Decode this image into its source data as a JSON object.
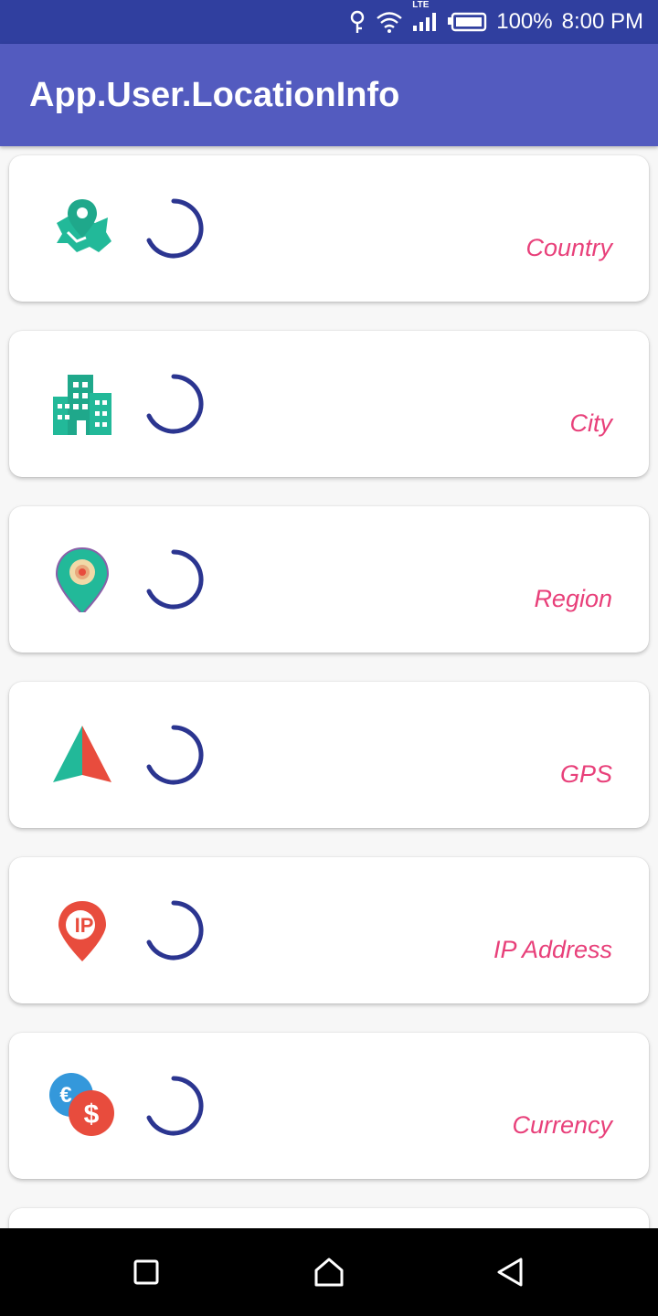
{
  "status_bar": {
    "network_label": "LTE",
    "battery_percent": "100%",
    "time": "8:00 PM",
    "icons": [
      "key-icon",
      "wifi-icon",
      "signal-icon",
      "battery-icon"
    ]
  },
  "app_bar": {
    "title": "App.User.LocationInfo"
  },
  "cards": [
    {
      "label": "Country",
      "icon": "country-map-pin-icon",
      "loading": true
    },
    {
      "label": "City",
      "icon": "city-buildings-icon",
      "loading": true
    },
    {
      "label": "Region",
      "icon": "region-pin-icon",
      "loading": true
    },
    {
      "label": "GPS",
      "icon": "gps-arrow-icon",
      "loading": true
    },
    {
      "label": "IP Address",
      "icon": "ip-pin-icon",
      "icon_text": "IP",
      "loading": true
    },
    {
      "label": "Currency",
      "icon": "currency-coins-icon",
      "icon_text": [
        "€",
        "$"
      ],
      "loading": true
    }
  ],
  "navigation_bar": {
    "buttons": [
      "recent-apps",
      "home",
      "back"
    ]
  },
  "colors": {
    "status_bar": "#303f9f",
    "app_bar": "#535bbf",
    "label": "#e8407a",
    "spinner": "#2b3590",
    "icon_teal": "#22b999",
    "icon_red": "#e84c3d"
  }
}
